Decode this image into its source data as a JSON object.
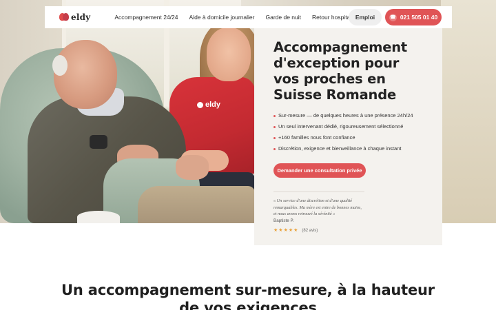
{
  "brand": {
    "name": "eldy",
    "accent_color": "#e05456",
    "logo_icon": "heart-logo-icon"
  },
  "nav": {
    "links": [
      "Accompagnement 24/24",
      "Aide à domicile journalier",
      "Garde de nuit",
      "Retour hospitalisation"
    ],
    "emploi_label": "Emploi",
    "phone_label": "021 505 01 40",
    "phone_icon": "phone-icon"
  },
  "hero": {
    "photo_shirt_logo": "eldy",
    "title": "Accompagnement d'exception pour vos proches en Suisse Romande",
    "bullets": [
      "Sur-mesure — de quelques heures à une présence 24h/24",
      "Un seul intervenant dédié, rigoureusement sélectionné",
      "+160 familles nous font confiance",
      "Discrétion, exigence et bienveillance à chaque instant"
    ],
    "cta_label": "Demander une consultation privée",
    "testimonial": {
      "quote": "« Un service d'une discrétion et d'une qualité remarquables. Ma mère est entre de bonnes mains, et nous avons retrouvé la sérénité »",
      "author": "Baptiste P.",
      "rating": 4.5,
      "stars": [
        "★",
        "★",
        "★",
        "★",
        "★"
      ],
      "reviews": "(82 avis)"
    }
  },
  "section": {
    "title": "Un accompagnement sur-mesure, à la hauteur de vos exigences"
  }
}
